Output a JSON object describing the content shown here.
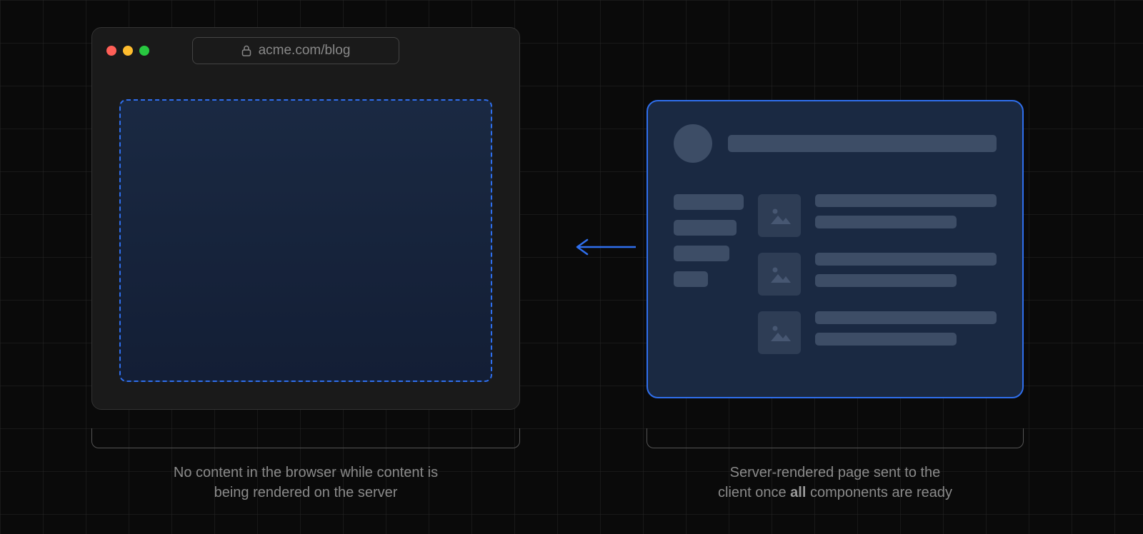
{
  "browser": {
    "url": "acme.com/blog",
    "traffic_lights": {
      "close": "#ff5f57",
      "minimize": "#febc2e",
      "zoom": "#28c840"
    }
  },
  "arrow": {
    "direction": "left",
    "color": "#2f6fed"
  },
  "captions": {
    "left_line1": "No content in the browser while content is",
    "left_line2": "being rendered on the server",
    "right_line1": "Server-rendered page sent to the",
    "right_prefix": "client once ",
    "right_bold": "all",
    "right_suffix": " components are ready"
  },
  "colors": {
    "accent": "#2f6fed",
    "panel_bg": "#1a2942",
    "skeleton": "#3d4d66"
  }
}
